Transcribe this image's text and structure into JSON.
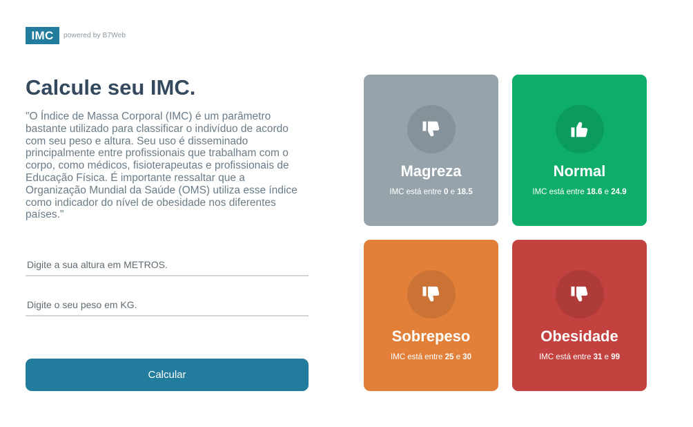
{
  "header": {
    "logo_text": "IMC",
    "powered_text": "powered by B7Web"
  },
  "main": {
    "title": "Calcule seu IMC.",
    "description": "\"O Índice de Massa Corporal (IMC) é um parâmetro bastante utilizado para classificar o indivíduo de acordo com seu peso e altura. Seu uso é disseminado principalmente entre profissionais que trabalham com o corpo, como médicos, fisioterapeutas e profissionais de Educação Física. É importante ressaltar que a Organização Mundial da Saúde (OMS) utiliza esse índice como indicador do nível de obesidade nos diferentes países.\"",
    "height_input": {
      "placeholder": "Digite a sua altura em METROS.",
      "value": ""
    },
    "weight_input": {
      "placeholder": "Digite o seu peso em KG.",
      "value": ""
    },
    "calculate_label": "Calcular"
  },
  "cards": [
    {
      "title": "Magreza",
      "prefix": "IMC está entre ",
      "min": "0",
      "joiner": " e ",
      "max": "18.5",
      "icon": "thumbs-down-icon",
      "color": "#96a3ab"
    },
    {
      "title": "Normal",
      "prefix": "IMC está entre ",
      "min": "18.6",
      "joiner": " e ",
      "max": "24.9",
      "icon": "thumbs-up-icon",
      "color": "#0ead69"
    },
    {
      "title": "Sobrepeso",
      "prefix": "IMC está entre ",
      "min": "25",
      "joiner": " e ",
      "max": "30",
      "icon": "thumbs-down-icon",
      "color": "#e2803a"
    },
    {
      "title": "Obesidade",
      "prefix": "IMC está entre ",
      "min": "31",
      "joiner": " e ",
      "max": "99",
      "icon": "thumbs-down-icon",
      "color": "#c3423f"
    }
  ]
}
